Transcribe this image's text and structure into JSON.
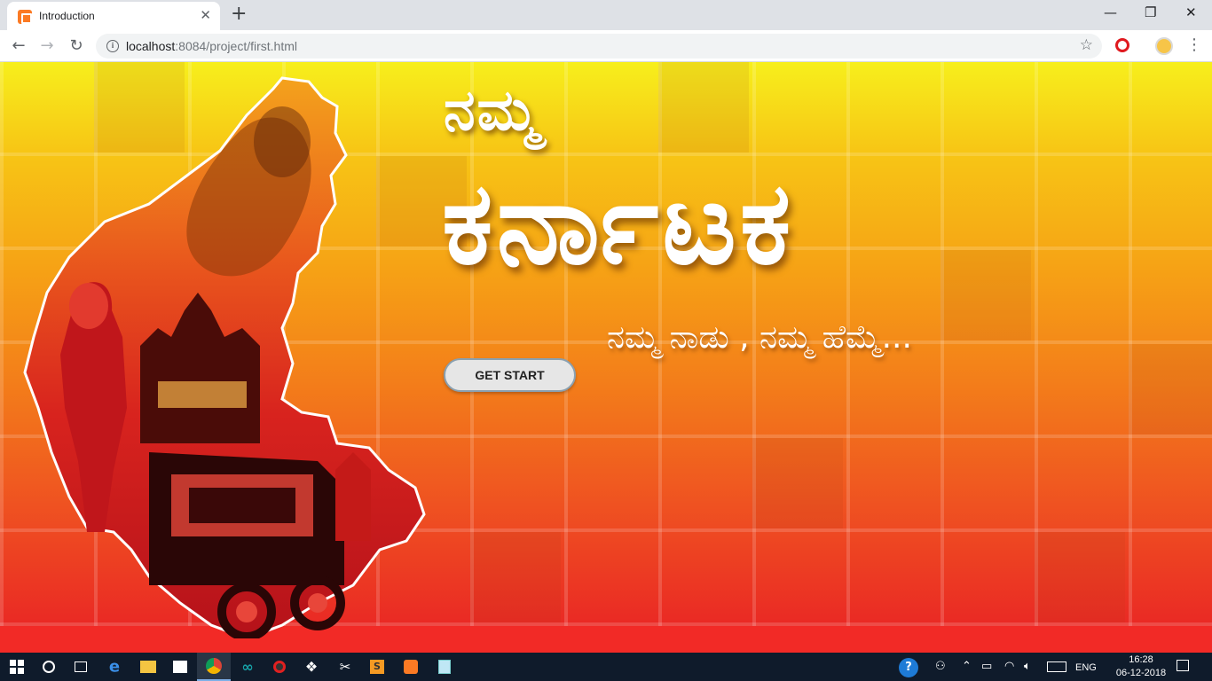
{
  "browser": {
    "tab_title": "Introduction",
    "url_host": "localhost",
    "url_rest": ":8084/project/first.html"
  },
  "page": {
    "title_small": "ನಮ್ಮ",
    "title_big": "ಕರ್ನಾಟಕ",
    "tagline": "ನಮ್ಮ ನಾಡು , ನಮ್ಮ ಹೆಮ್ಮೆ...",
    "cta_label": "GET START"
  },
  "taskbar": {
    "language": "ENG",
    "time": "16:28",
    "date": "06-12-2018"
  },
  "colors": {
    "bg_top": "#f7ef1c",
    "bg_bottom": "#ee2626",
    "taskbar": "#0f1b2b",
    "map_red": "#d8231e",
    "map_dark": "#3a0d08"
  }
}
